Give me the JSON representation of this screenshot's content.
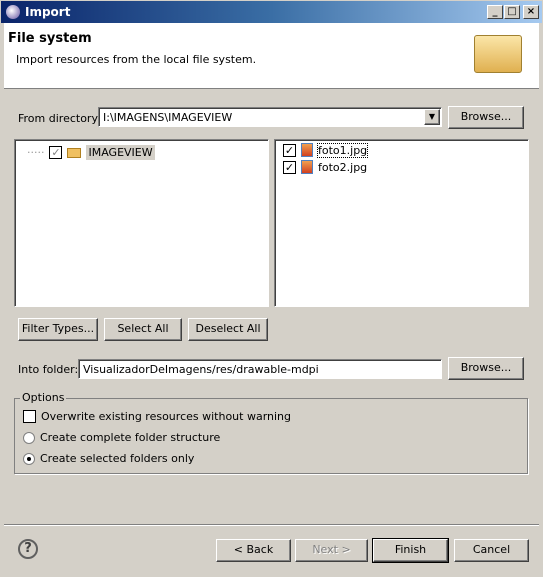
{
  "window": {
    "title": "Import"
  },
  "header": {
    "title": "File system",
    "description": "Import resources from the local file system."
  },
  "from_directory": {
    "label": "From directory:",
    "value": "I:\\IMAGENS\\IMAGEVIEW",
    "browse": "Browse..."
  },
  "tree": {
    "items": [
      {
        "label": "IMAGEVIEW",
        "checked": "grayed"
      }
    ]
  },
  "files": {
    "items": [
      {
        "label": "foto1.jpg",
        "checked": true
      },
      {
        "label": "foto2.jpg",
        "checked": true
      }
    ]
  },
  "buttons": {
    "filter_types": "Filter Types...",
    "select_all": "Select All",
    "deselect_all": "Deselect All"
  },
  "into_folder": {
    "label": "Into folder:",
    "value": "VisualizadorDeImagens/res/drawable-mdpi",
    "browse": "Browse..."
  },
  "options": {
    "title": "Options",
    "overwrite": "Overwrite existing resources without warning",
    "complete_structure": "Create complete folder structure",
    "selected_only": "Create selected folders only",
    "selected": "selected_only"
  },
  "footer": {
    "help": "?",
    "back": "< Back",
    "next": "Next >",
    "finish": "Finish",
    "cancel": "Cancel"
  }
}
